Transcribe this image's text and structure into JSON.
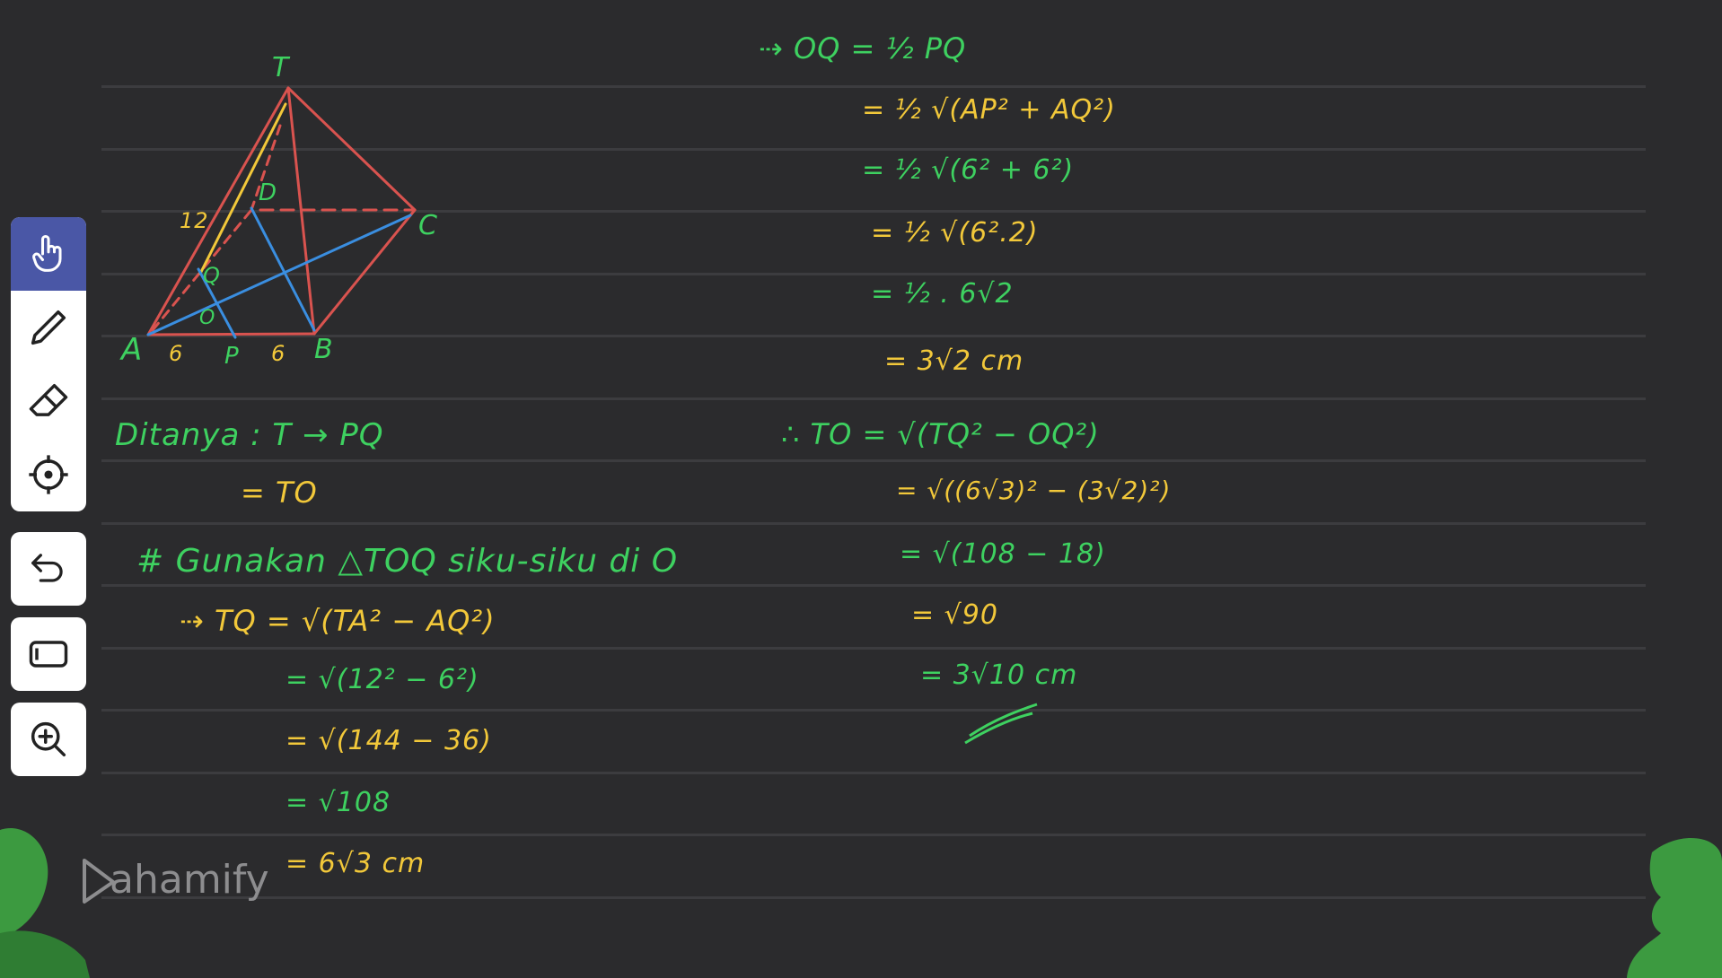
{
  "app": {
    "brand": "Pahamify",
    "brand_text": "ahamify"
  },
  "toolbar": {
    "tools": [
      {
        "name": "hand-tool",
        "icon": "hand-pointer-icon",
        "active": true
      },
      {
        "name": "pen-tool",
        "icon": "pencil-icon",
        "active": false
      },
      {
        "name": "eraser-tool",
        "icon": "eraser-icon",
        "active": false
      },
      {
        "name": "laser-pointer-tool",
        "icon": "crosshair-icon",
        "active": false
      }
    ],
    "undo": {
      "icon": "undo-icon"
    },
    "clear": {
      "icon": "blank-page-icon"
    },
    "zoom": {
      "icon": "zoom-in-icon"
    }
  },
  "colors": {
    "background": "#2b2b2d",
    "green_ink": "#3ed160",
    "yellow_ink": "#f2c83a",
    "red_ink": "#d9534f",
    "blue_ink": "#3a8ee0",
    "active_tool": "#4a57a6",
    "leaf": "#3c9a40"
  },
  "diagram": {
    "labels": {
      "T": "T",
      "A": "A",
      "B": "B",
      "C": "C",
      "D": "D",
      "P": "P",
      "Q": "Q",
      "O": "O",
      "edge_TA": "12",
      "AP": "6",
      "PB": "6"
    }
  },
  "left_notes": {
    "asked": "Ditanya : T → PQ",
    "asked_eq": "= TO",
    "use": "# Gunakan △TOQ siku-siku di O",
    "tq_lines": [
      "⇢ TQ = √(TA² − AQ²)",
      "= √(12² − 6²)",
      "= √(144 − 36)",
      "= √108",
      "= 6√3 cm"
    ]
  },
  "right_notes": {
    "oq_lines": [
      "⇢ OQ = ½ PQ",
      "= ½ √(AP² + AQ²)",
      "= ½ √(6² + 6²)",
      "= ½ √(6².2)",
      "= ½ . 6√2",
      "= 3√2 cm"
    ],
    "to_lines": [
      "∴ TO = √(TQ² − OQ²)",
      "= √((6√3)² − (3√2)²)",
      "= √(108 − 18)",
      "= √90",
      "= 3√10 cm"
    ]
  }
}
